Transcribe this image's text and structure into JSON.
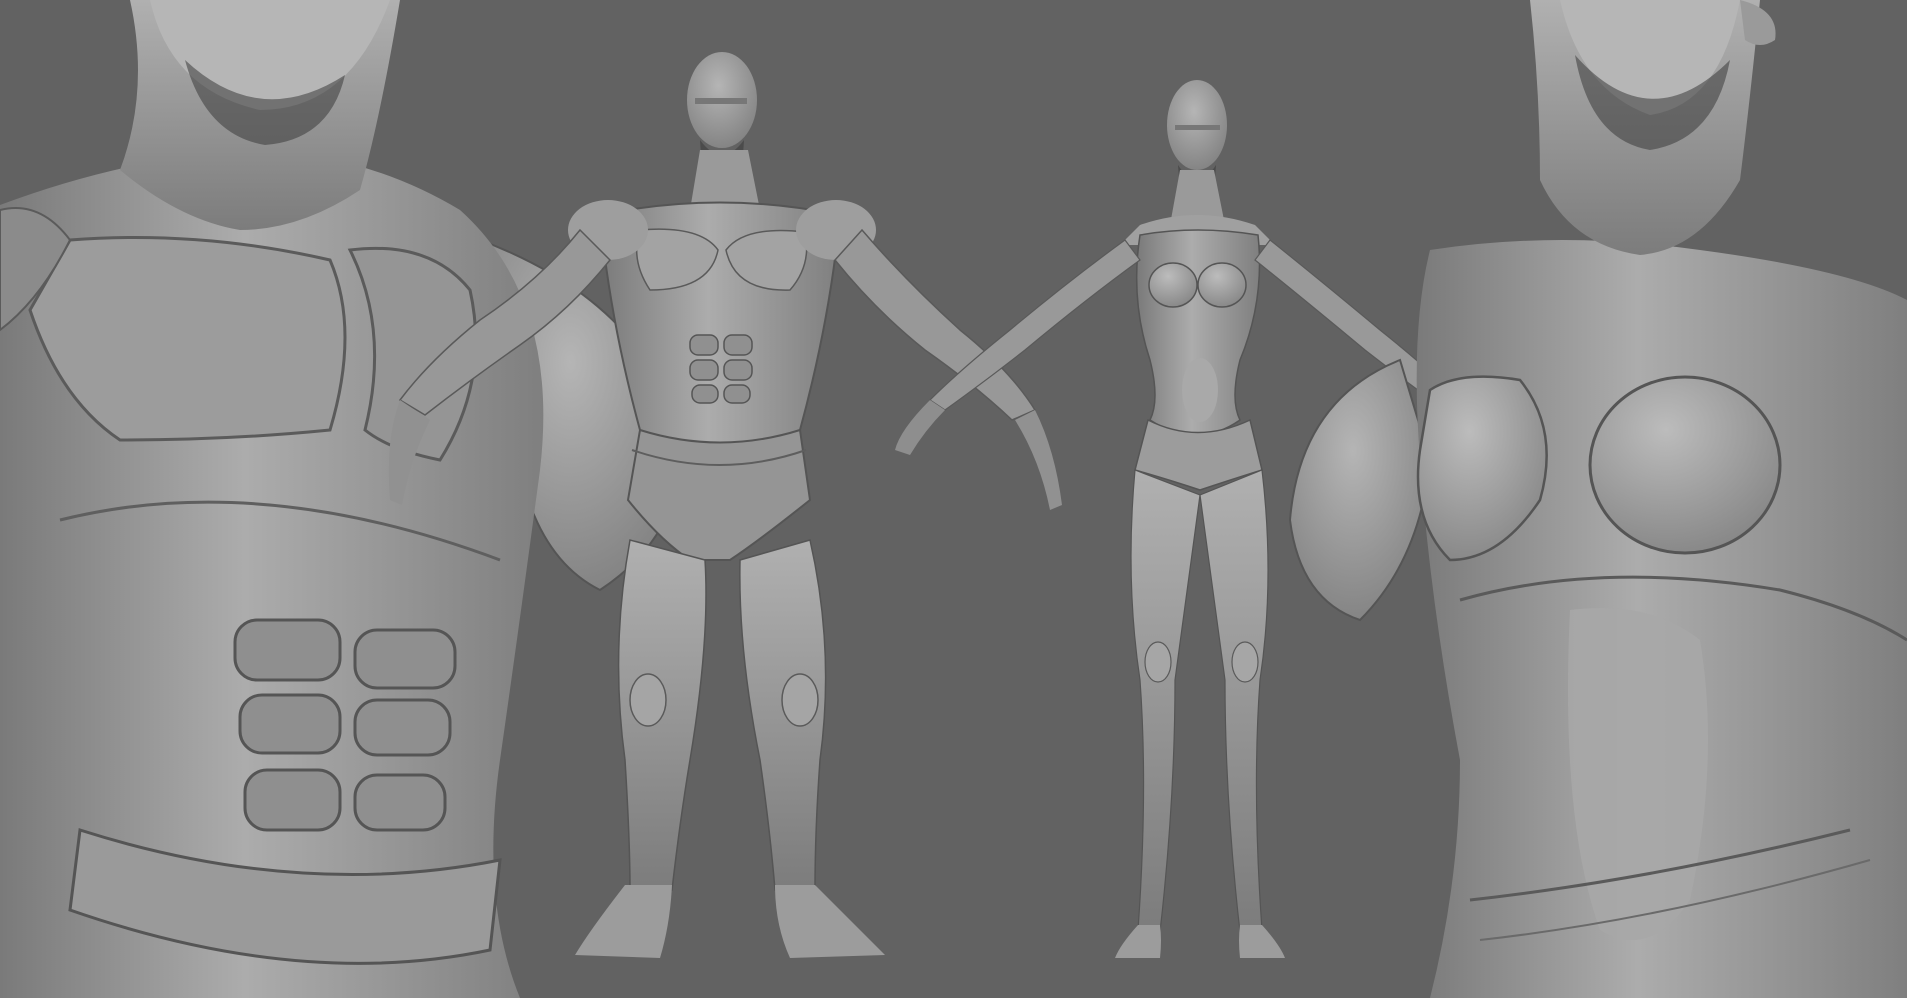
{
  "scene": {
    "description_colors": {
      "background": "#626262",
      "clay_light": "#a9a9a9",
      "clay_mid": "#8e8e8e",
      "clay_dark": "#6a6a6a",
      "crease": "#4a4a4a"
    },
    "figures": [
      {
        "id": "male-torso-closeup"
      },
      {
        "id": "male-full-body"
      },
      {
        "id": "female-full-body"
      },
      {
        "id": "female-torso-closeup"
      }
    ]
  }
}
